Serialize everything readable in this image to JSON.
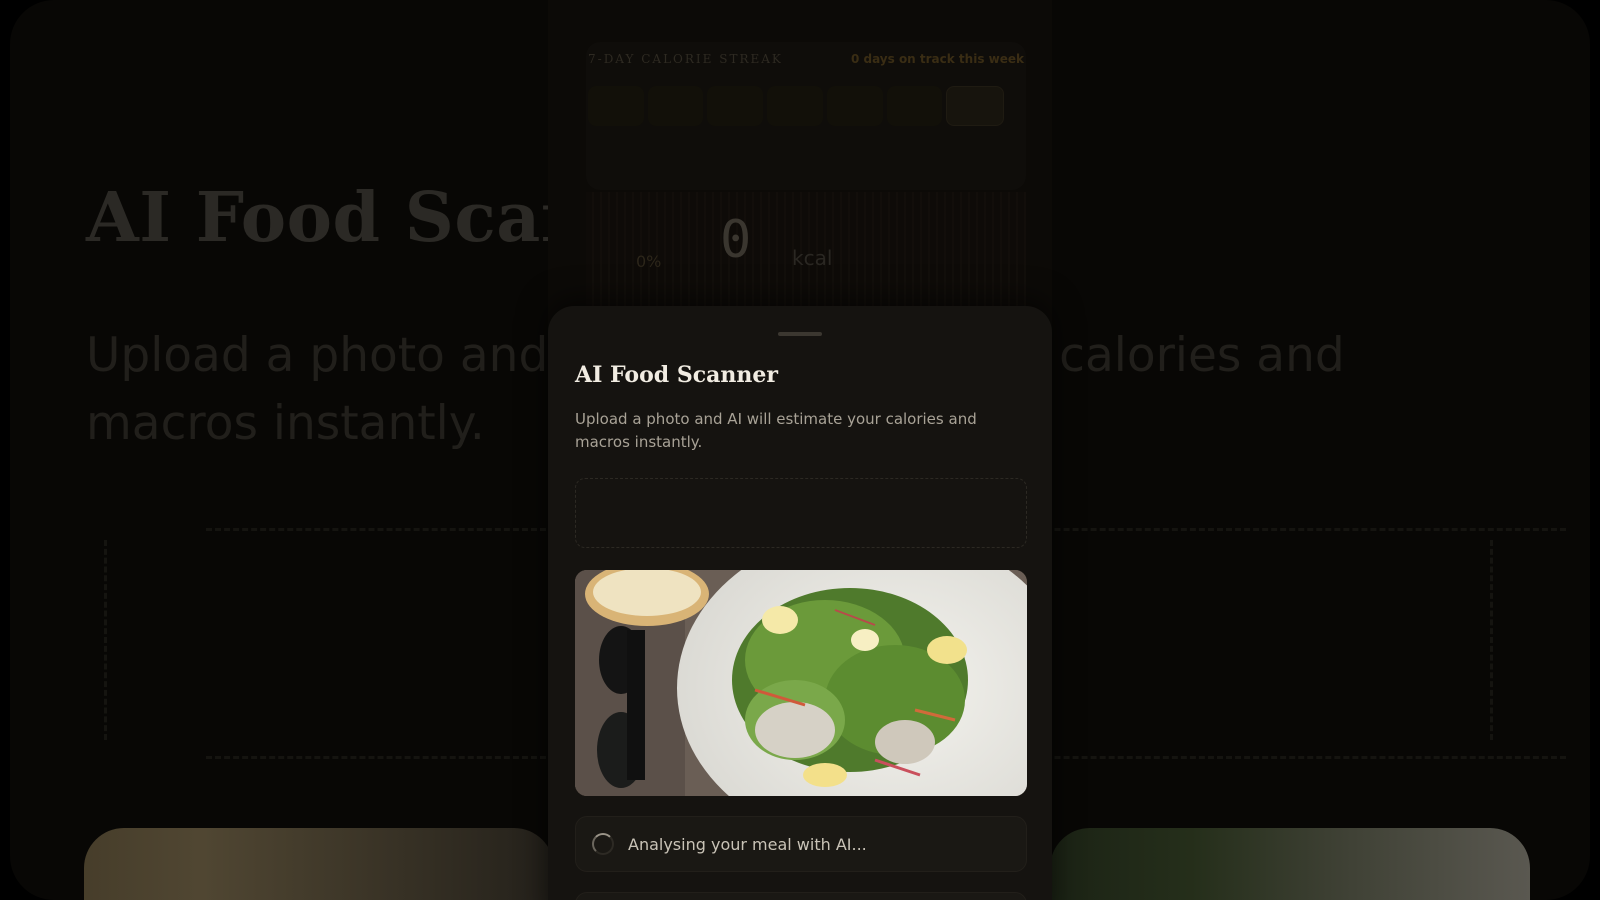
{
  "background": {
    "title": "AI Food Scanner",
    "subtitle": "Upload a photo and AI will estimate your calories and macros instantly."
  },
  "dashboard": {
    "streak_title": "7-DAY CALORIE STREAK",
    "streak_count": "0 days on track this week"
  },
  "calories": {
    "value": "0",
    "unit": "kcal",
    "percent": "0%"
  },
  "sheet": {
    "title": "AI Food Scanner",
    "subtitle": "Upload a photo and AI will estimate your calories and macros instantly.",
    "status_text": "Analysing your meal with AI..."
  },
  "colors": {
    "sheet_bg": "#151310",
    "page_bg": "#000000",
    "title": "#f1ece2",
    "muted": "#a8a296"
  }
}
